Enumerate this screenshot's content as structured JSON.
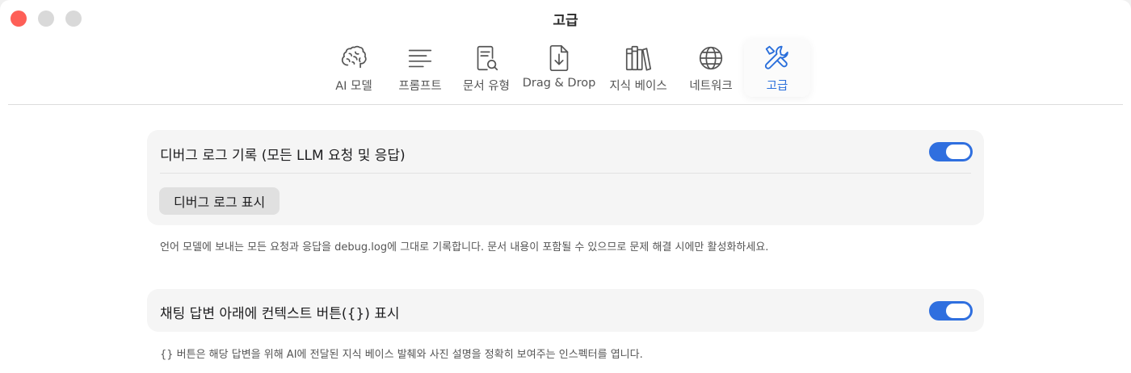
{
  "window": {
    "title": "고급"
  },
  "tabs": [
    {
      "label": "AI 모델",
      "icon": "brain-icon"
    },
    {
      "label": "프롬프트",
      "icon": "text-lines-icon"
    },
    {
      "label": "문서 유형",
      "icon": "document-search-icon"
    },
    {
      "label": "Drag & Drop",
      "icon": "document-download-icon"
    },
    {
      "label": "지식 베이스",
      "icon": "books-icon"
    },
    {
      "label": "네트워크",
      "icon": "globe-icon"
    },
    {
      "label": "고급",
      "icon": "tools-icon",
      "active": true
    }
  ],
  "settings": {
    "debug_log": {
      "label": "디버그 로그 기록 (모든 LLM 요청 및 응답)",
      "enabled": true,
      "button_label": "디버그 로그 표시",
      "caption": "언어 모델에 보내는 모든 요청과 응답을 debug.log에 그대로 기록합니다. 문서 내용이 포함될 수 있으므로 문제 해결 시에만 활성화하세요."
    },
    "context_button": {
      "label": "채팅 답변 아래에 컨텍스트 버튼({}) 표시",
      "enabled": true,
      "caption": "{} 버튼은 해당 답변을 위해 AI에 전달된 지식 베이스 발췌와 사진 설명을 정확히 보여주는 인스펙터를 엽니다."
    }
  },
  "colors": {
    "accent": "#2f6fdf",
    "close": "#fe5f57",
    "inactive_light": "#d9d9d9"
  }
}
